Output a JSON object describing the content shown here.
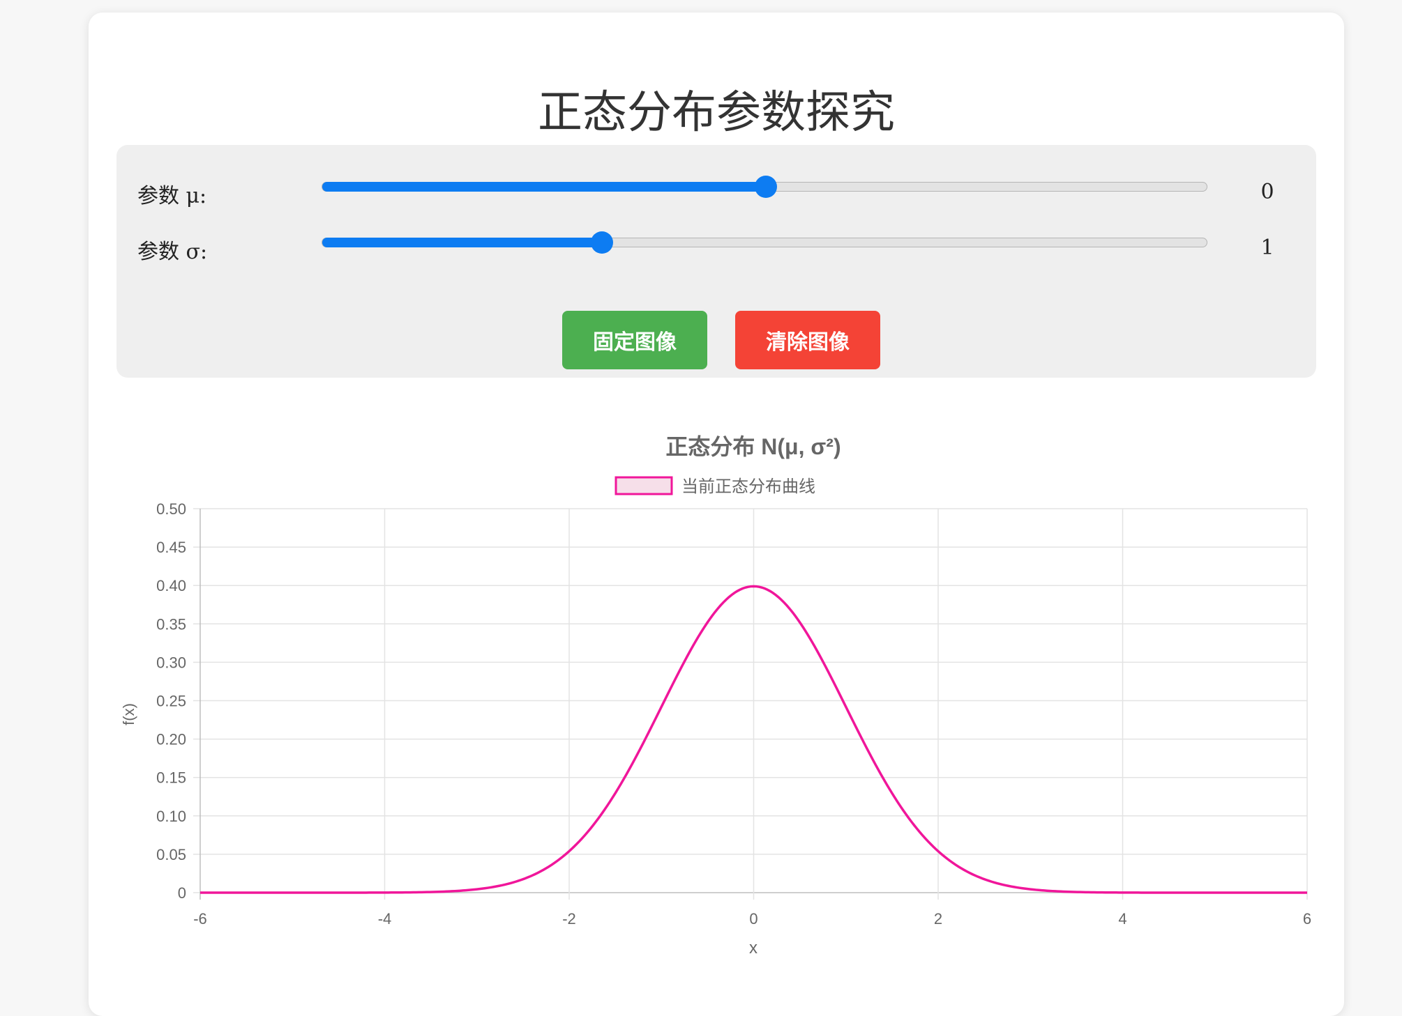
{
  "page": {
    "title": "正态分布参数探究"
  },
  "controls": {
    "mu": {
      "label": "参数 μ:",
      "value": "0",
      "min": -5,
      "max": 5,
      "current": 0
    },
    "sigma": {
      "label": "参数 σ:",
      "value": "1",
      "min": 0.1,
      "max": 3,
      "current": 1
    },
    "fix_button": "固定图像",
    "clear_button": "清除图像"
  },
  "colors": {
    "accent": "#0d7cf2",
    "fix": "#4caf50",
    "clear": "#f44336",
    "curve": "#f0169a"
  },
  "chart_data": {
    "type": "line",
    "title": "正态分布 N(μ, σ²)",
    "xlabel": "x",
    "ylabel": "f(x)",
    "xlim": [
      -6,
      6
    ],
    "ylim": [
      0,
      0.5
    ],
    "x_ticks": [
      "-6",
      "-4",
      "-2",
      "0",
      "2",
      "4",
      "6"
    ],
    "y_ticks": [
      "0",
      "0.05",
      "0.10",
      "0.15",
      "0.20",
      "0.25",
      "0.30",
      "0.35",
      "0.40",
      "0.45",
      "0.50"
    ],
    "grid": true,
    "legend_position": "top",
    "series": [
      {
        "name": "当前正态分布曲线",
        "mu": 0,
        "sigma": 1,
        "x": [
          -6,
          -5,
          -4,
          -3.5,
          -3,
          -2.5,
          -2,
          -1.5,
          -1,
          -0.5,
          0,
          0.5,
          1,
          1.5,
          2,
          2.5,
          3,
          3.5,
          4,
          5,
          6
        ],
        "values": [
          0.0,
          0.0,
          0.0001,
          0.0009,
          0.0044,
          0.0175,
          0.054,
          0.1295,
          0.242,
          0.3521,
          0.3989,
          0.3521,
          0.242,
          0.1295,
          0.054,
          0.0175,
          0.0044,
          0.0009,
          0.0001,
          0.0,
          0.0
        ]
      }
    ]
  }
}
